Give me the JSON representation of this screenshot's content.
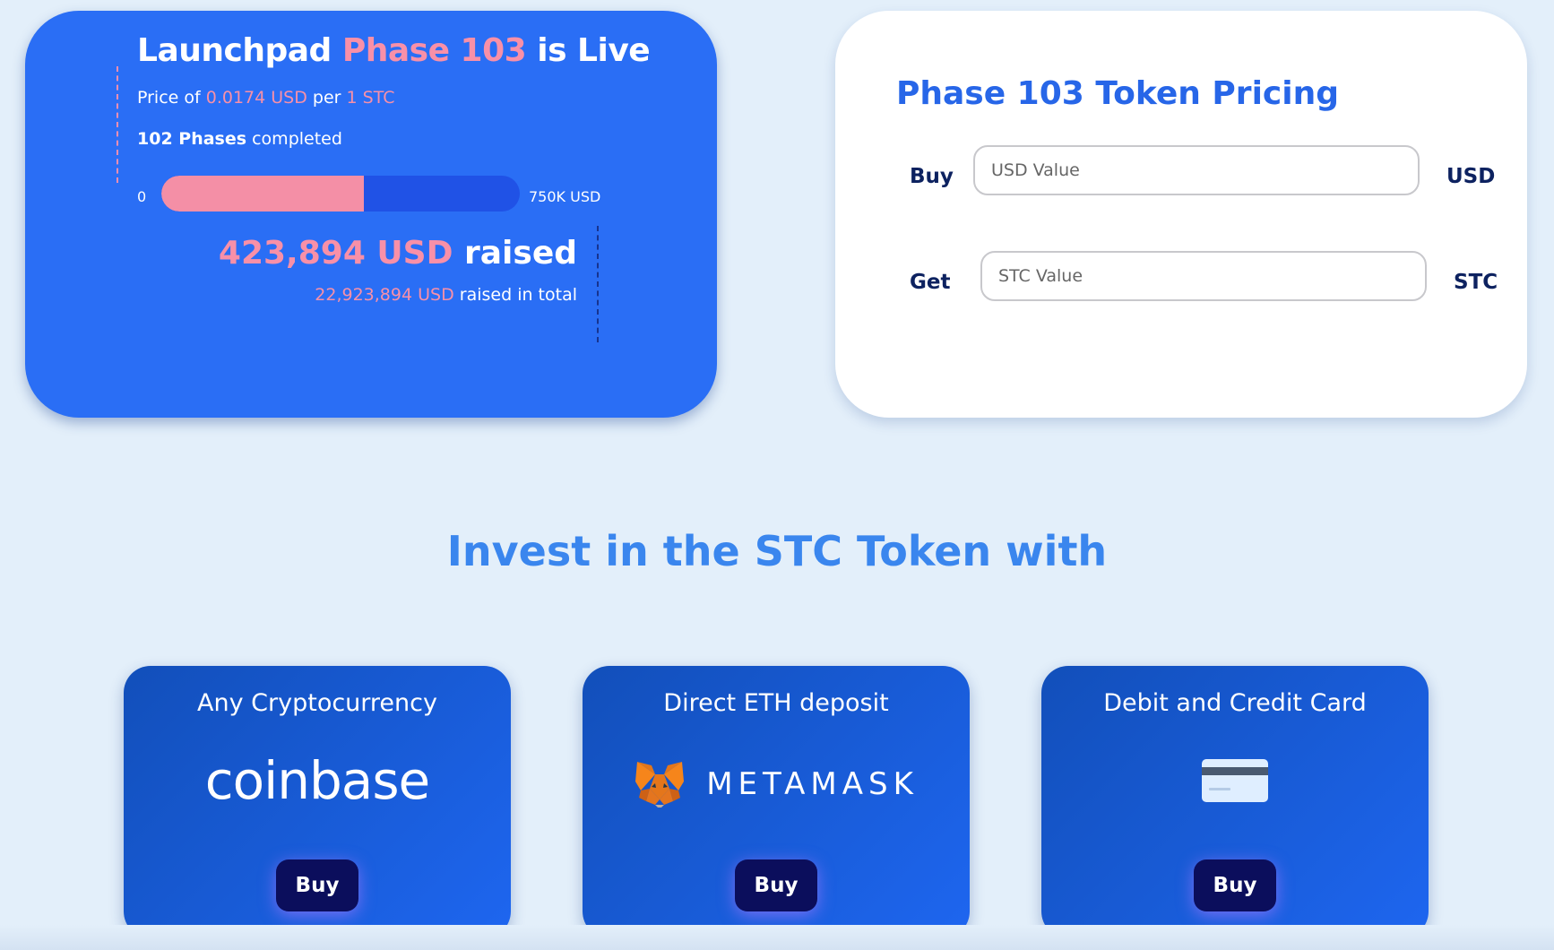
{
  "launchpad": {
    "title_prefix": "Launchpad",
    "title_phase": "Phase 103",
    "title_suffix": "is Live",
    "price_prefix": "Price of",
    "price_value": "0.0174 USD",
    "price_mid": "per",
    "price_unit": "1 STC",
    "phases_count": "102 Phases",
    "phases_suffix": "completed",
    "bar_min": "0",
    "bar_max": "750K USD",
    "progress_fraction": 0.565,
    "raised_amount": "423,894 USD",
    "raised_label": "raised",
    "total_amount": "22,923,894 USD",
    "total_label": "raised in total"
  },
  "pricing": {
    "title": "Phase 103 Token Pricing",
    "buy_label": "Buy",
    "buy_placeholder": "USD Value",
    "buy_unit": "USD",
    "get_label": "Get",
    "get_placeholder": "STC Value",
    "get_unit": "STC"
  },
  "invest": {
    "heading": "Invest in the STC Token with",
    "options": [
      {
        "title": "Any Cryptocurrency",
        "logo_text": "coinbase",
        "button": "Buy"
      },
      {
        "title": "Direct ETH deposit",
        "logo_text": "METAMASK",
        "icon": "metamask-fox-icon",
        "button": "Buy"
      },
      {
        "title": "Debit and Credit Card",
        "icon": "credit-card-icon",
        "button": "Buy"
      }
    ]
  },
  "colors": {
    "accent_blue": "#2a6ef5",
    "pink": "#f890a8",
    "dark_navy": "#0d2260",
    "heading_blue": "#3a86ee"
  }
}
